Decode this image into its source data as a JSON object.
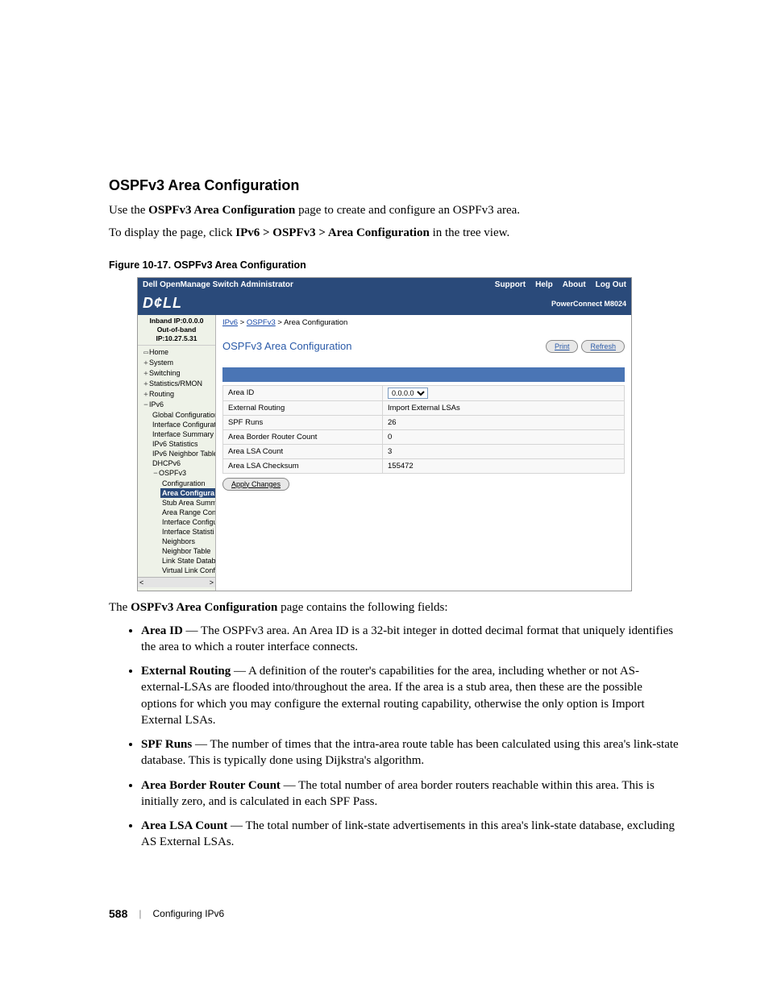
{
  "heading": "OSPFv3 Area Configuration",
  "intro1_pre": "Use the ",
  "intro1_bold": "OSPFv3 Area Configuration",
  "intro1_post": " page to create and configure an OSPFv3 area.",
  "intro2_pre": "To display the page, click ",
  "intro2_bold": "IPv6 > OSPFv3 > Area Configuration",
  "intro2_post": " in the tree view.",
  "figure_label": "Figure 10-17.    OSPFv3 Area Configuration",
  "topbar": {
    "title": "Dell OpenManage Switch Administrator",
    "links": [
      "Support",
      "Help",
      "About",
      "Log Out"
    ]
  },
  "brand": {
    "logo": "D¢LL",
    "model": "PowerConnect M8024"
  },
  "ip": {
    "inband": "Inband IP:0.0.0.0",
    "outband": "Out-of-band IP:10.27.5.31"
  },
  "tree": {
    "home": "Home",
    "system": "System",
    "switching": "Switching",
    "stats": "Statistics/RMON",
    "routing": "Routing",
    "ipv6": "IPv6",
    "ipv6_children": [
      "Global Configuration",
      "Interface Configurat",
      "Interface Summary",
      "IPv6 Statistics",
      "IPv6 Neighbor Table",
      "DHCPv6"
    ],
    "ospfv3": "OSPFv3",
    "ospfv3_children": [
      "Configuration",
      "Area Configura",
      "Stub Area Summ",
      "Area Range Con",
      "Interface Configu",
      "Interface Statisti",
      "Neighbors",
      "Neighbor Table",
      "Link State Datab",
      "Virtual Link Conf"
    ]
  },
  "breadcrumb": {
    "a1": "IPv6",
    "a2": "OSPFv3",
    "tail": "Area Configuration"
  },
  "panel": {
    "title": "OSPFv3 Area Configuration",
    "print": "Print",
    "refresh": "Refresh",
    "apply": "Apply Changes"
  },
  "rows": [
    {
      "label": "Area ID",
      "value": "0.0.0.0",
      "select": true
    },
    {
      "label": "External Routing",
      "value": "Import External LSAs"
    },
    {
      "label": "SPF Runs",
      "value": "26"
    },
    {
      "label": "Area Border Router Count",
      "value": "0"
    },
    {
      "label": "Area LSA Count",
      "value": "3"
    },
    {
      "label": "Area LSA Checksum",
      "value": "155472"
    }
  ],
  "after_fig_pre": "The ",
  "after_fig_bold": "OSPFv3 Area Configuration",
  "after_fig_post": " page contains the following fields:",
  "bullets": [
    {
      "term": "Area ID",
      "desc": " — The OSPFv3 area. An Area ID is a 32-bit integer in dotted decimal format that uniquely identifies the area to which a router interface connects."
    },
    {
      "term": "External Routing",
      "desc": " — A definition of the router's capabilities for the area, including whether or not AS-external-LSAs are flooded into/throughout the area. If the area is a stub area, then these are the possible options for which you may configure the external routing capability, otherwise the only option is Import External LSAs."
    },
    {
      "term": "SPF Runs",
      "desc": " — The number of times that the intra-area route table has been calculated using this area's link-state database. This is typically done using Dijkstra's algorithm."
    },
    {
      "term": "Area Border Router Count",
      "desc": " — The total number of area border routers reachable within this area. This is initially zero, and is calculated in each SPF Pass."
    },
    {
      "term": "Area LSA Count",
      "desc": " — The total number of link-state advertisements in this area's link-state database, excluding AS External LSAs."
    }
  ],
  "footer": {
    "page": "588",
    "chapter": "Configuring IPv6"
  }
}
